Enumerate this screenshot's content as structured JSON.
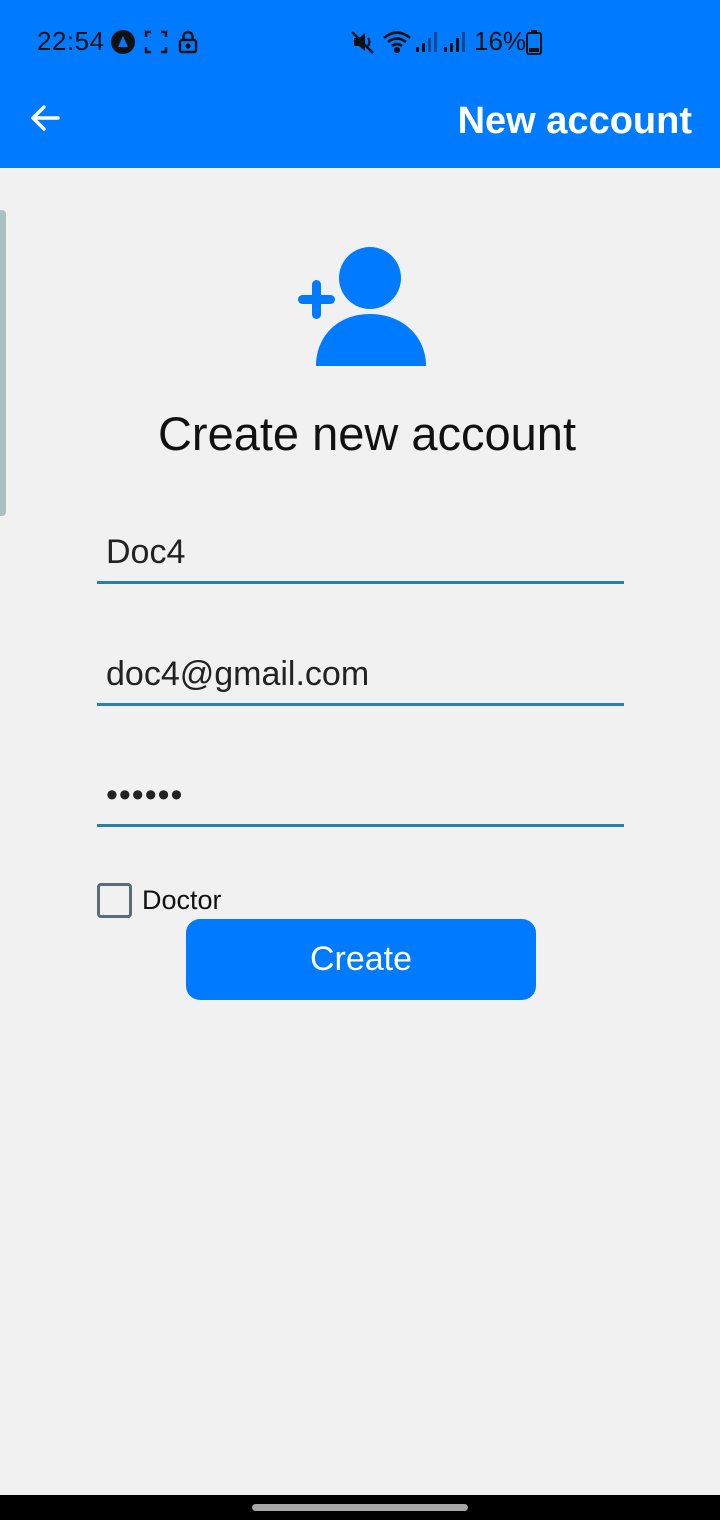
{
  "status_bar": {
    "time": "22:54",
    "battery_percent": "16%",
    "icons": [
      "app-notification-icon",
      "screenshot-icon",
      "lock-icon",
      "mute-icon",
      "wifi-icon",
      "signal-icon",
      "signal-icon",
      "battery-icon"
    ]
  },
  "app_bar": {
    "title": "New account",
    "back_icon": "arrow-left-icon"
  },
  "hero": {
    "icon": "person-add-icon",
    "heading": "Create new account"
  },
  "form": {
    "name_value": "Doc4",
    "email_value": "doc4@gmail.com",
    "password_value": "••••••",
    "doctor_checkbox": {
      "label": "Doctor",
      "checked": false
    },
    "submit_label": "Create"
  },
  "colors": {
    "primary": "#007bff",
    "background": "#f1f1f1",
    "field_underline": "#2b7fa8"
  }
}
